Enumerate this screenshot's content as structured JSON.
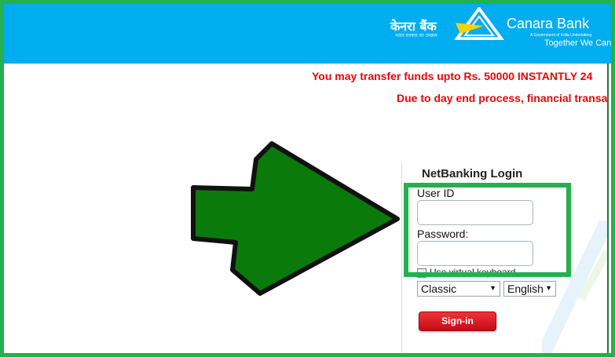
{
  "header": {
    "logo_hindi": "केनरा बैंक",
    "logo_hindi_sub": "भारत सरकार का उपक्रम",
    "logo_name": "Canara Bank",
    "logo_sub": "A Government of India Undertaking",
    "tagline": "Together We Can",
    "background_color": "#00adef"
  },
  "messages": [
    "You may transfer funds upto Rs. 50000 INSTANTLY 24",
    "Due to day end process, financial transa"
  ],
  "login": {
    "title": "NetBanking Login",
    "user_id_label": "User ID",
    "user_id_value": "",
    "password_label": "Password:",
    "password_value": "",
    "virtual_keyboard_label": "Use virtual keyboard",
    "mode_selected": "Classic",
    "language_selected": "English",
    "signin_label": "Sign-in"
  },
  "annotation": {
    "icon": "arrow-right-icon",
    "arrow_color": "#0a7a0a",
    "highlight_color": "#22b14c"
  }
}
